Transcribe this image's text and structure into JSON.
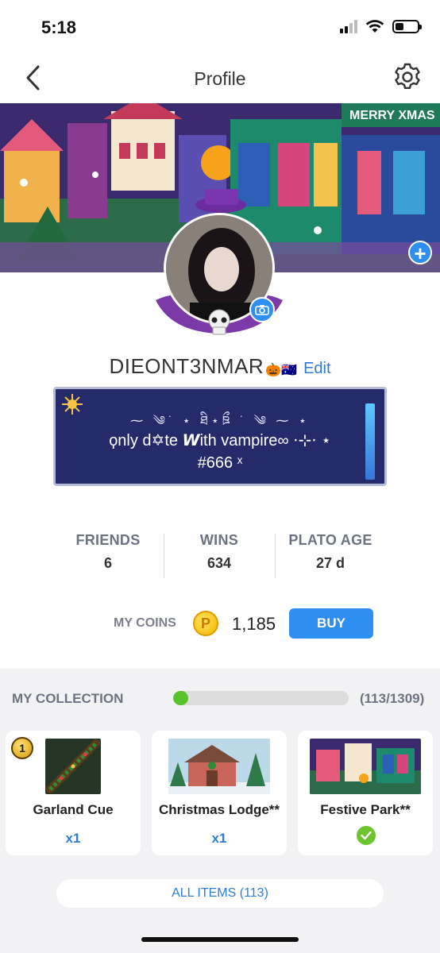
{
  "status_bar": {
    "time": "5:18",
    "signal_bars_filled": 2,
    "battery_level": 0.4
  },
  "nav": {
    "title": "Profile",
    "back_icon": "chevron-left-icon",
    "settings_icon": "gear-icon"
  },
  "banner": {
    "sign_text": "MERRY XMAS",
    "add_icon": "plus-icon"
  },
  "profile": {
    "username": "DIEONT3NMAR",
    "username_emojis": "🎃🇦🇺",
    "edit_label": "Edit",
    "camera_icon": "camera-icon",
    "bio_deco": "⁓ ༄˙ ⋆ ཐི⋆ཋྀ ˙ ༄ ⁓ ⋆",
    "bio_line1": "ϙnly d✡te 𝙒ith vampire∞ ⋅⊹⋅ ⋆",
    "bio_line2": "#666 ˣ"
  },
  "stats": [
    {
      "label": "FRIENDS",
      "value": "6"
    },
    {
      "label": "WINS",
      "value": "634"
    },
    {
      "label": "PLATO AGE",
      "value": "27 d"
    }
  ],
  "coins": {
    "label": "MY COINS",
    "coin_symbol": "P",
    "value": "1,185",
    "buy_label": "BUY"
  },
  "collection": {
    "title": "MY COLLECTION",
    "count": "(113/1309)",
    "progress_fraction": 0.0863,
    "items": [
      {
        "name": "Garland Cue",
        "qty": "x1",
        "badge": "1",
        "owned_icon": null
      },
      {
        "name": "Christmas Lodge**",
        "qty": "x1",
        "badge": null,
        "owned_icon": null
      },
      {
        "name": "Festive Park**",
        "qty": null,
        "badge": null,
        "owned_icon": "checkmark-icon"
      }
    ],
    "all_items_label": "ALL ITEMS (113)"
  },
  "colors": {
    "accent_blue": "#2f8ff0",
    "link_blue": "#2e7cd6",
    "progress_green": "#5ac22a",
    "bio_bg": "#242a6a"
  }
}
